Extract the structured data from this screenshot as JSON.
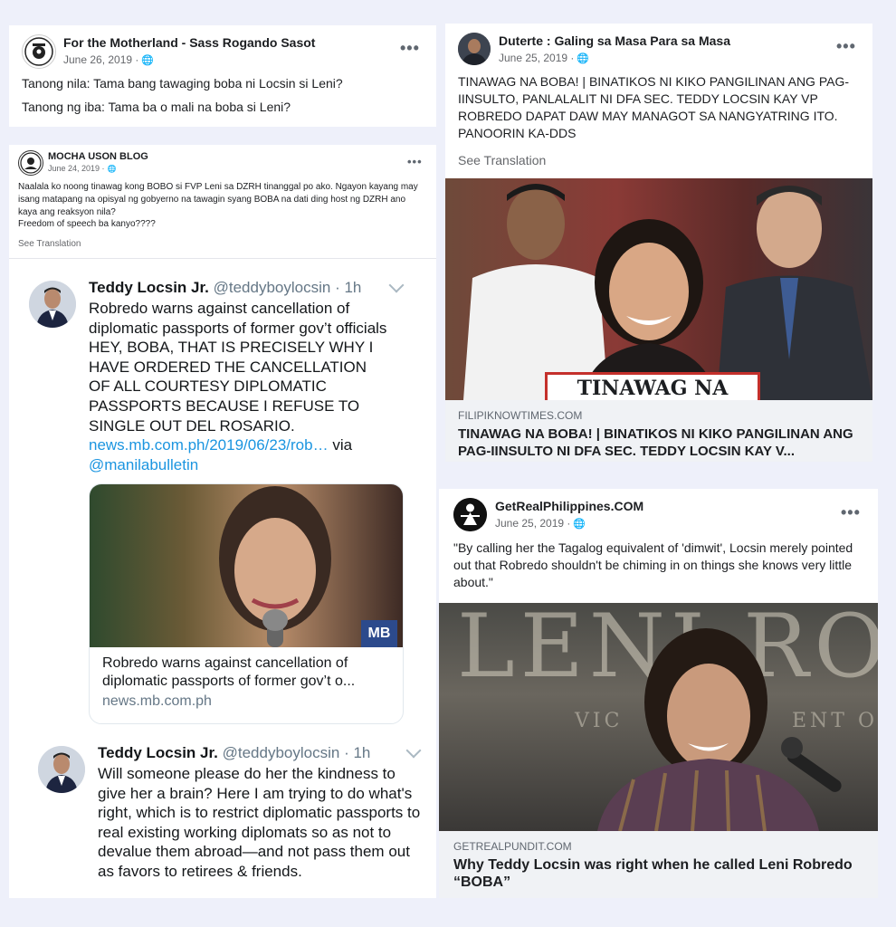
{
  "post1": {
    "page_name": "For the Motherland - Sass Rogando Sasot",
    "date": "June 26, 2019 ·",
    "line1": "Tanong nila: Tama bang tawaging boba ni Locsin si Leni?",
    "line2": "Tanong ng iba: Tama ba o mali na boba si Leni?"
  },
  "post2": {
    "page_name": "MOCHA USON BLOG",
    "date": "June 24, 2019 ·",
    "text": "Naalala ko noong tinawag kong BOBO si FVP Leni sa DZRH tinanggal po ako. Ngayon kayang may isang matapang na opisyal ng gobyerno na tawagin syang BOBA na dati ding host ng DZRH ano kaya ang reaksyon nila?",
    "text2": "Freedom of speech ba kanyo????",
    "see_translation": "See Translation"
  },
  "tweet1": {
    "name": "Teddy Locsin Jr.",
    "handle": "@teddyboylocsin · 1h",
    "text": "Robredo warns against cancellation of diplomatic passports of former gov’t officials HEY, BOBA, THAT IS PRECISELY WHY I HAVE ORDERED THE CANCELLATION OF ALL COURTESY DIPLOMATIC PASSPORTS BECAUSE I REFUSE TO SINGLE OUT DEL ROSARIO.",
    "link": "news.mb.com.ph/2019/06/23/rob…",
    "via": " via",
    "mention": "@manilabulletin",
    "card_title": "Robredo warns against cancellation of diplomatic passports of former gov’t o...",
    "card_domain": "news.mb.com.ph",
    "badge": "MB"
  },
  "tweet2": {
    "name": "Teddy Locsin Jr.",
    "handle": "@teddyboylocsin · 1h",
    "text": "Will someone please do her the kindness to give her a brain? Here I am trying to do what's right, which is to restrict diplomatic passports to real existing working diplomats so as not to devalue them abroad—and not pass them out as favors to retirees & friends."
  },
  "post3": {
    "page_name": "Duterte : Galing sa Masa Para sa Masa",
    "date": "June 25, 2019 ·",
    "text": "TINAWAG NA BOBA! | BINATIKOS NI KIKO PANGILINAN ANG PAG-IINSULTO, PANLALALIT NI DFA SEC. TEDDY LOCSIN KAY VP ROBREDO DAPAT DAW MAY MANAGOT SA NANGYATRING ITO. PANOORIN KA-DDS",
    "see_translation": "See Translation",
    "banner": "TINAWAG NA BOBA!",
    "link_domain": "FILIPIKNOWTIMES.COM",
    "link_title": "TINAWAG NA BOBA! | BINATIKOS NI KIKO PANGILINAN ANG PAG-IINSULTO NI DFA SEC. TEDDY LOCSIN KAY V..."
  },
  "post4": {
    "page_name": "GetRealPhilippines.COM",
    "date": "June 25, 2019 ·",
    "text": "\"By calling her the Tagalog equivalent of 'dimwit', Locsin merely pointed out that Robredo shouldn't be chiming in on things she knows very little about.\"",
    "wall_text": "LENI RO",
    "wall_sub": "VIC",
    "wall_sub2": "ENT O",
    "link_domain": "GETREALPUNDIT.COM",
    "link_title": "Why Teddy Locsin was right when he called Leni Robredo “BOBA”"
  },
  "icons": {
    "more": "•••",
    "globe": "🌐"
  }
}
